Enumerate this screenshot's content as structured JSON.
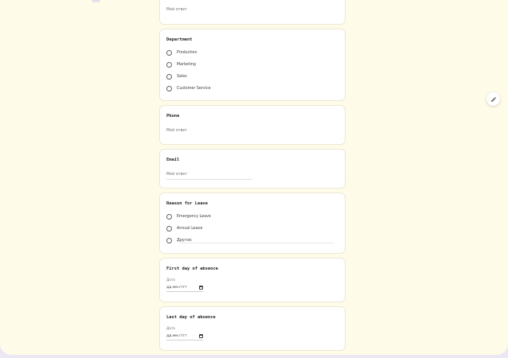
{
  "form": {
    "answer_placeholder": "Мой ответ",
    "date_label": "Дата",
    "date_placeholder": "дд.мм.гггг",
    "questions": {
      "department": {
        "title": "Department",
        "options": [
          "Production",
          "Marketing",
          "Sales",
          "Customer Service"
        ]
      },
      "phone": {
        "title": "Phone"
      },
      "email": {
        "title": "Email"
      },
      "reason": {
        "title": "Reason for Leave",
        "options": [
          "Emergency Leave",
          "Annual Leave",
          "Другое:"
        ]
      },
      "first_day": {
        "title": "First day of absence"
      },
      "last_day": {
        "title": "Last day of absence"
      }
    }
  },
  "icons": {
    "edit": "pencil-icon",
    "radio": "radio-circle",
    "calendar": "calendar-icon"
  },
  "colors": {
    "page_background": "#fffbe9",
    "outer_background": "#ece8f3",
    "card_background": "#ffffff",
    "text_primary": "#202124",
    "text_secondary": "#70757a"
  }
}
